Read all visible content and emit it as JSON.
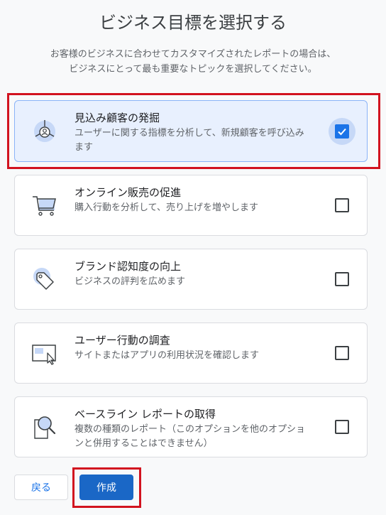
{
  "header": {
    "title": "ビジネス目標を選択する",
    "description_line1": "お客様のビジネスに合わせてカスタマイズされたレポートの場合は、",
    "description_line2": "ビジネスにとって最も重要なトピックを選択してください。"
  },
  "options": [
    {
      "title": "見込み顧客の発掘",
      "desc_line1": "ユーザーに関する指標を分析して、新規顧客を呼び込み",
      "desc_line2": "ます",
      "icon": "lead-generation-icon",
      "checked": true
    },
    {
      "title": "オンライン販売の促進",
      "desc_line1": "購入行動を分析して、売り上げを増やします",
      "desc_line2": "",
      "icon": "shopping-cart-icon",
      "checked": false
    },
    {
      "title": "ブランド認知度の向上",
      "desc_line1": "ビジネスの評判を広めます",
      "desc_line2": "",
      "icon": "tag-icon",
      "checked": false
    },
    {
      "title": "ユーザー行動の調査",
      "desc_line1": "サイトまたはアプリの利用状況を確認します",
      "desc_line2": "",
      "icon": "browser-cursor-icon",
      "checked": false
    },
    {
      "title": "ベースライン レポートの取得",
      "desc_line1": "複数の種類のレポート（このオプションを他のオプショ",
      "desc_line2": "ンと併用することはできません）",
      "icon": "magnifier-report-icon",
      "checked": false
    }
  ],
  "footer": {
    "back_label": "戻る",
    "create_label": "作成"
  },
  "colors": {
    "accent": "#1a73e8",
    "selected_bg": "#e8f0fe",
    "highlight_red": "#d2131f"
  }
}
